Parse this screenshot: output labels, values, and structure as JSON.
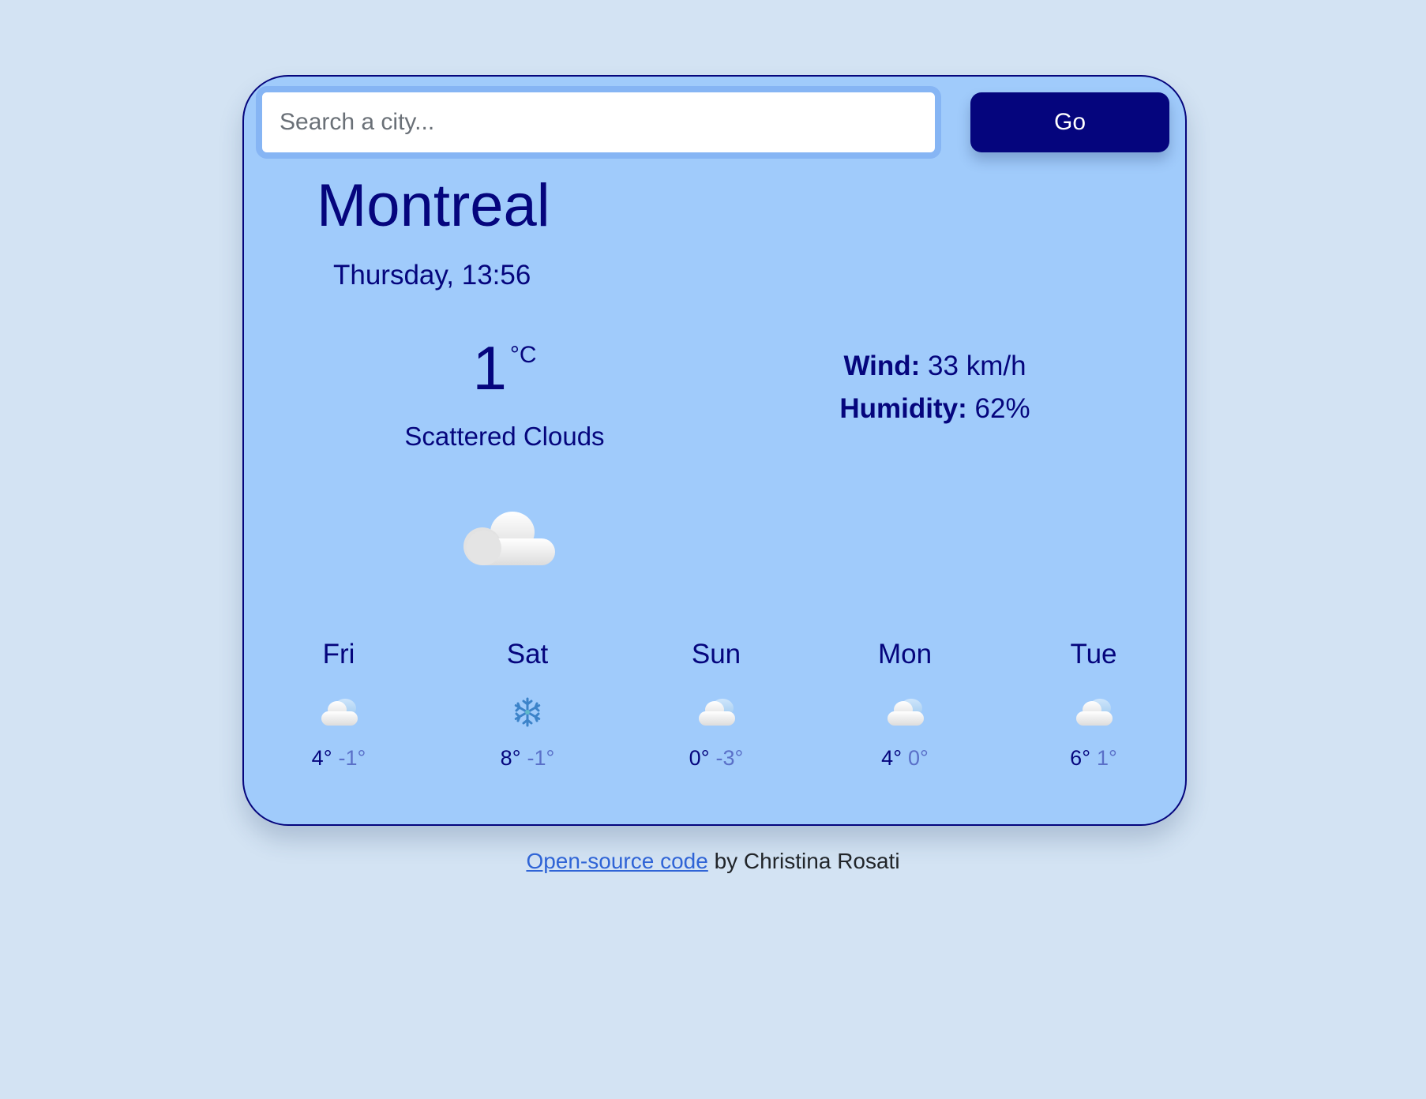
{
  "search": {
    "placeholder": "Search a city...",
    "value": "",
    "button_label": "Go"
  },
  "current": {
    "city": "Montreal",
    "datetime": "Thursday, 13:56",
    "temperature": "1",
    "unit": "°C",
    "description": "Scattered Clouds",
    "icon": "cloud-icon",
    "wind_label": "Wind:",
    "wind_value": "33 km/h",
    "humidity_label": "Humidity:",
    "humidity_value": "62%"
  },
  "forecast": [
    {
      "day": "Fri",
      "icon": "cloud-icon",
      "max": "4°",
      "min": "-1°"
    },
    {
      "day": "Sat",
      "icon": "snowflake-icon",
      "max": "8°",
      "min": "-1°"
    },
    {
      "day": "Sun",
      "icon": "cloud-icon",
      "max": "0°",
      "min": "-3°"
    },
    {
      "day": "Mon",
      "icon": "cloud-icon",
      "max": "4°",
      "min": "0°"
    },
    {
      "day": "Tue",
      "icon": "cloud-icon",
      "max": "6°",
      "min": "1°"
    }
  ],
  "footer": {
    "link_text": "Open-source code",
    "author_text": " by Christina Rosati"
  },
  "colors": {
    "page_background": "#d3e3f3",
    "card_background": "#a0cbfb",
    "primary": "#05057d",
    "min_temp": "#5a70c8",
    "link": "#2f64d6"
  }
}
